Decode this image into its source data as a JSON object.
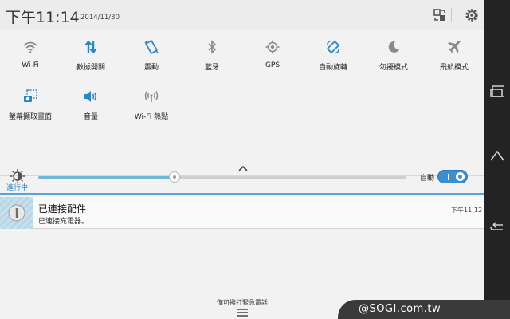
{
  "status": {
    "time": "下午11:14",
    "date": "2014/11/30"
  },
  "header_icons": [
    {
      "name": "switch-user-icon"
    },
    {
      "name": "settings-gear-icon"
    }
  ],
  "quick_settings": {
    "row1": [
      {
        "label": "Wi-Fi",
        "icon": "wifi-icon",
        "active": false
      },
      {
        "label": "數據開關",
        "icon": "mobile-data-icon",
        "active": true
      },
      {
        "label": "震動",
        "icon": "vibrate-icon",
        "active": true
      },
      {
        "label": "藍牙",
        "icon": "bluetooth-icon",
        "active": false
      },
      {
        "label": "GPS",
        "icon": "gps-icon",
        "active": false
      },
      {
        "label": "自動旋轉",
        "icon": "auto-rotate-icon",
        "active": true
      },
      {
        "label": "勿擾模式",
        "icon": "do-not-disturb-icon",
        "active": false
      },
      {
        "label": "飛航模式",
        "icon": "airplane-mode-icon",
        "active": false
      }
    ],
    "row2": [
      {
        "label": "螢幕擷取畫面",
        "icon": "screenshot-icon",
        "active": true
      },
      {
        "label": "音量",
        "icon": "volume-icon",
        "active": true
      },
      {
        "label": "Wi-Fi 熱點",
        "icon": "wifi-hotspot-icon",
        "active": false
      }
    ]
  },
  "brightness": {
    "level": 0.37,
    "auto_label": "自動",
    "auto_enabled": true
  },
  "ongoing": {
    "section_label": "進行中",
    "notification": {
      "title": "已連接配件",
      "text": "已連接充電器。",
      "time": "下午11:12"
    }
  },
  "footer": {
    "emergency_text": "僅可撥打緊急電話"
  },
  "watermark": "@SOGI.com.tw",
  "colors": {
    "accent": "#2d86c4",
    "inactive_icon": "#7a7a7a",
    "nav_bar": "#232323"
  }
}
